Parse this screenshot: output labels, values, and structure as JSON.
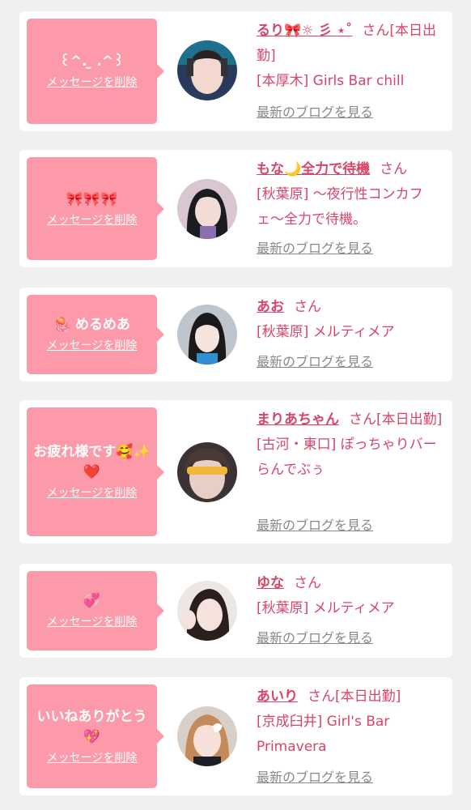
{
  "delete_label": "メッセージを削除",
  "blog_label": "最新のブログを見る",
  "san": "さん",
  "accent_color": "#d7456a",
  "bubble_color": "#fc9aa9",
  "cards": [
    {
      "message": "꒰^.  ̫ .^꒱",
      "name": "るり🎀☼ 彡 ⋆˚",
      "status": "[本日出勤]",
      "shop": "[本厚木] Girls Bar chill"
    },
    {
      "message": "🎀🎀🎀",
      "name": "もな🌙全力で待機",
      "status": "",
      "shop": "[秋葉原] 〜夜行性コンカフェ〜全力で待機。"
    },
    {
      "message": "🪼 めるめあ",
      "name": "あお",
      "status": "",
      "shop": "[秋葉原] メルティメア"
    },
    {
      "message": "お疲れ様です🥰✨❤️",
      "name": "まりあちゃん",
      "status": "[本日出勤]",
      "shop": "[古河・東口] ぽっちゃりバー らんでぶぅ"
    },
    {
      "message": "💞",
      "name": "ゆな",
      "status": "",
      "shop": "[秋葉原] メルティメア"
    },
    {
      "message": "いいねありがとう💖",
      "name": "あいり",
      "status": "[本日出勤]",
      "shop": "[京成臼井] Girl's Bar Primavera"
    }
  ]
}
